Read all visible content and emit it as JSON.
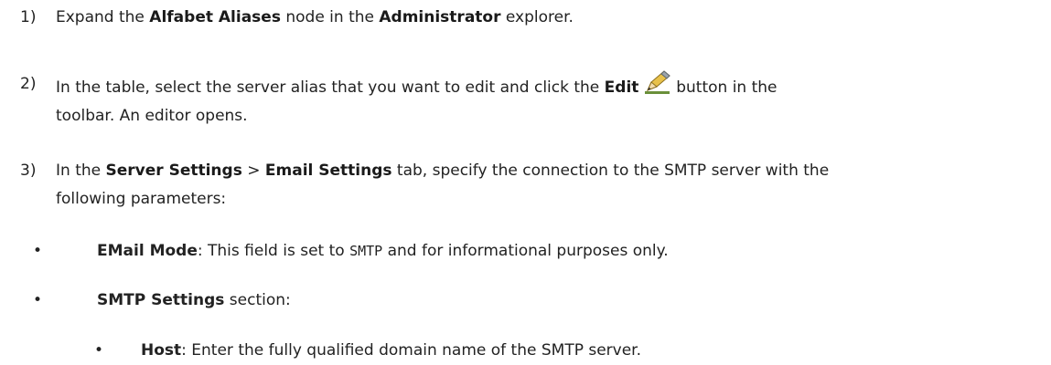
{
  "steps": [
    {
      "num": "1)",
      "p1": "Expand the ",
      "b1": "Alfabet Aliases",
      "p2": " node in the ",
      "b2": "Administrator",
      "p3": " explorer."
    },
    {
      "num": "2)",
      "p1": "In the table, select the server alias that you want to edit and click the ",
      "b1": "Edit",
      "icon": "pencil-icon",
      "p2": " button in the",
      "line2": "toolbar. An editor opens."
    },
    {
      "num": "3)",
      "p1": "In the ",
      "b1": "Server Settings",
      "p2": " > ",
      "b2": "Email Settings",
      "p3": " tab, specify the connection to the SMTP server with the",
      "line2": "following parameters:"
    }
  ],
  "bullets": [
    {
      "bold": "EMail Mode",
      "p1": ": This field is set to ",
      "code": "SMTP",
      "p2": " and for informational purposes only."
    },
    {
      "bold": "SMTP Settings",
      "p1": " section:"
    }
  ],
  "subbullets": [
    {
      "bold": "Host",
      "p1": ": Enter the fully qualified domain name of the SMTP server."
    }
  ],
  "bullet_char": "•"
}
